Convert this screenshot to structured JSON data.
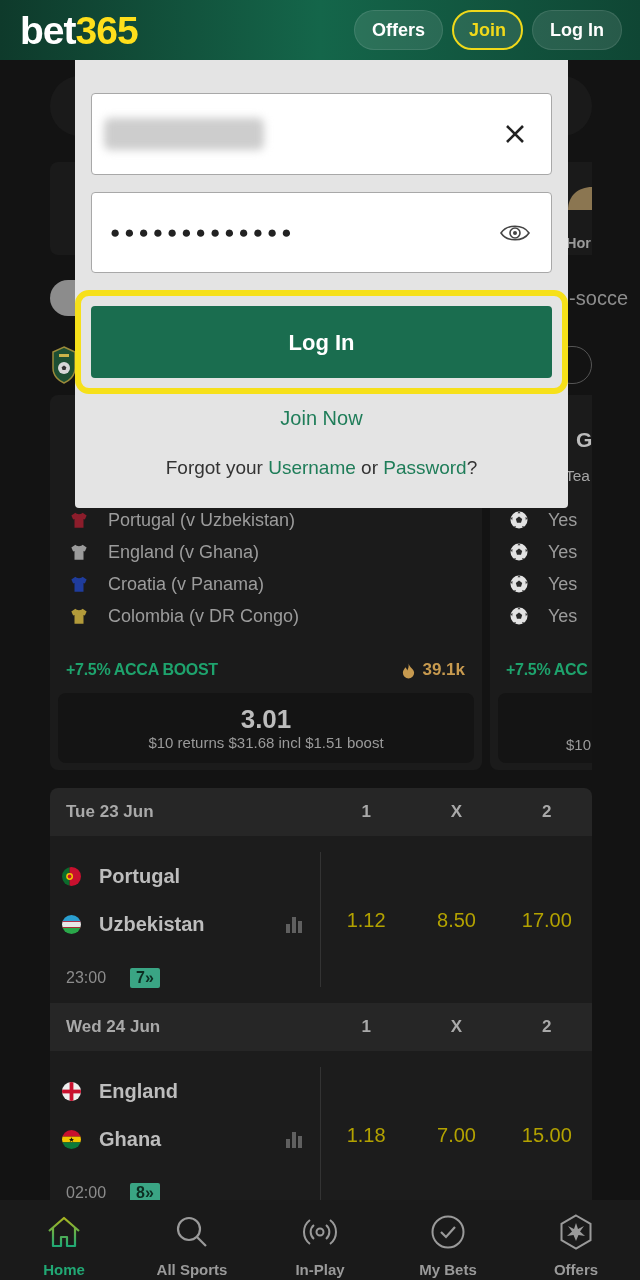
{
  "header": {
    "logo": {
      "text": "bet",
      "accent": "365"
    },
    "buttons": [
      {
        "label": "Offers",
        "kind": "plain"
      },
      {
        "label": "Join",
        "kind": "outlined"
      },
      {
        "label": "Log In",
        "kind": "plain"
      }
    ]
  },
  "background": {
    "sport_tiles": [
      {
        "label": "Hor"
      }
    ],
    "chip_row": {
      "trailing_text": "-socce"
    },
    "cards": [
      {
        "selections": [
          {
            "kind": "jersey",
            "label": "Portugal (v Uzbekistan)",
            "color": "#8c1d2b"
          },
          {
            "kind": "jersey",
            "label": "England (v Ghana)",
            "color": "#9b9b9b"
          },
          {
            "kind": "jersey",
            "label": "Croatia (v Panama)",
            "color": "#1f3c9c"
          },
          {
            "kind": "jersey",
            "label": "Colombia (v DR Congo)",
            "color": "#b39b3a"
          }
        ],
        "boost": "+7.5% ACCA BOOST",
        "popularity": "39.1k",
        "odds": "3.01",
        "returns": "$10 returns $31.68 incl $1.51 boost"
      },
      {
        "title": "G",
        "subtitle": "Tea",
        "selections": [
          {
            "kind": "ball",
            "label": "Yes"
          },
          {
            "kind": "ball",
            "label": "Yes"
          },
          {
            "kind": "ball",
            "label": "Yes"
          },
          {
            "kind": "ball",
            "label": "Yes"
          }
        ],
        "boost": "+7.5% ACC",
        "returns": "$10"
      }
    ],
    "matches": [
      {
        "date": "Tue 23 Jun",
        "columns": [
          "1",
          "X",
          "2"
        ],
        "teams": [
          {
            "name": "Portugal",
            "kind": "portugal"
          },
          {
            "name": "Uzbekistan",
            "kind": "uzbekistan"
          }
        ],
        "time": "23:00",
        "markets": "7»",
        "odds": [
          "1.12",
          "8.50",
          "17.00"
        ]
      },
      {
        "date": "Wed 24 Jun",
        "columns": [
          "1",
          "X",
          "2"
        ],
        "teams": [
          {
            "name": "England",
            "kind": "england"
          },
          {
            "name": "Ghana",
            "kind": "ghana"
          }
        ],
        "time": "02:00",
        "markets": "8»",
        "odds": [
          "1.18",
          "7.00",
          "15.00"
        ]
      }
    ]
  },
  "login_panel": {
    "username": {
      "blurred": true
    },
    "password": {
      "value": "●●●●●●●●●●●●●"
    },
    "login_button": {
      "label": "Log In",
      "focused": true
    },
    "join_link": "Join Now",
    "forgot_text": [
      {
        "kind": "text",
        "text": "Forgot your "
      },
      {
        "kind": "link",
        "text": "Username"
      },
      {
        "kind": "text",
        "text": " or "
      },
      {
        "kind": "link",
        "text": "Password"
      },
      {
        "kind": "text",
        "text": "?"
      }
    ]
  },
  "bottom_nav": [
    {
      "kind": "home",
      "label": "Home",
      "selected": true
    },
    {
      "kind": "search",
      "label": "All Sports",
      "selected": false
    },
    {
      "kind": "live",
      "label": "In-Play",
      "selected": false
    },
    {
      "kind": "check",
      "label": "My Bets",
      "selected": false
    },
    {
      "kind": "star",
      "label": "Offers",
      "selected": false
    }
  ]
}
